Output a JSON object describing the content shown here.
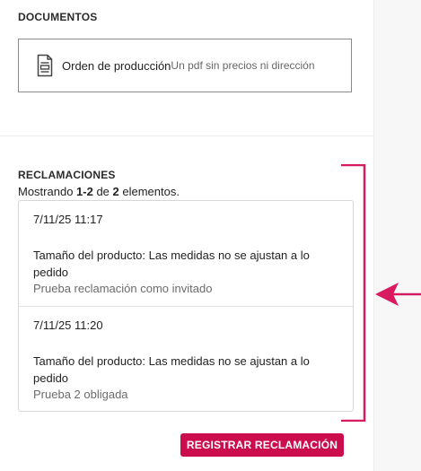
{
  "documents": {
    "title": "DOCUMENTOS",
    "item": {
      "icon": "document-icon",
      "name": "Orden de producción",
      "description": "Un pdf sin precios ni dirección"
    }
  },
  "claims": {
    "title": "RECLAMACIONES",
    "count": {
      "prefix": "Mostrando ",
      "range": "1-2",
      "middle": " de ",
      "total": "2",
      "suffix": " elementos."
    },
    "items": [
      {
        "date": "7/11/25 11:17",
        "reason": "Tamaño del producto: Las medidas no se ajustan a lo pedido",
        "note": "Prueba reclamación como invitado"
      },
      {
        "date": "7/11/25 11:20",
        "reason": "Tamaño del producto: Las medidas no se ajustan a lo pedido",
        "note": "Prueba 2 obligada"
      }
    ],
    "register_label": "REGISTRAR RECLAMACIÓN"
  },
  "annotation": {
    "color": "#d81b60",
    "bracket": "bracket-highlight",
    "arrow": "arrow-left-icon"
  },
  "colors": {
    "accent": "#cc0d4d",
    "border": "#8a8a8a"
  }
}
